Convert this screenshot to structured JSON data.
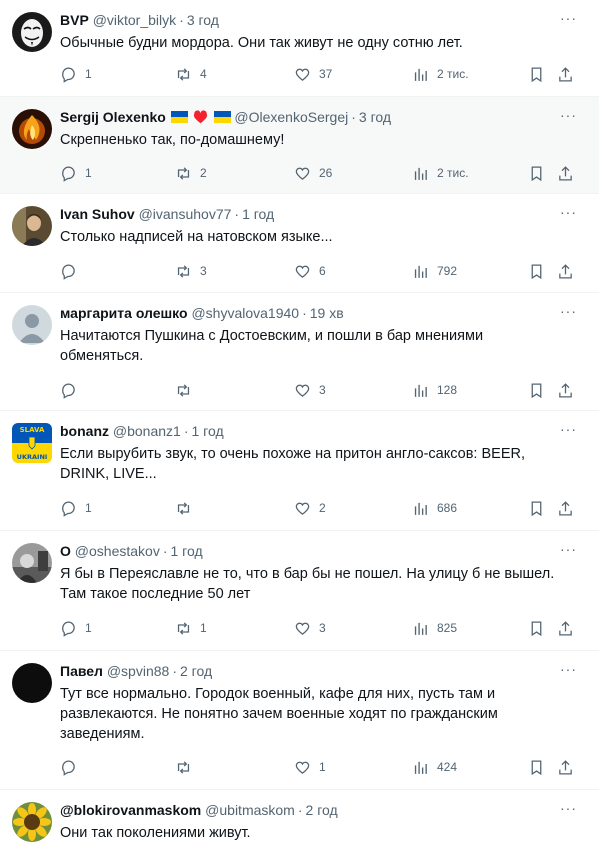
{
  "replies": [
    {
      "name": "BVP",
      "handle": "@viktor_bilyk",
      "time": "3 год",
      "text": "Обычные будни мордора. Они так живут не одну сотню лет.",
      "replies": "1",
      "reposts": "4",
      "likes": "37",
      "views": "2 тис.",
      "highlight": false,
      "avatar": "anonymous-mask"
    },
    {
      "name": "Sergij Olexenko",
      "handle": "@OlexenkoSergej",
      "time": "3 год",
      "text": "Скрепненько так, по-домашнему!",
      "replies": "1",
      "reposts": "2",
      "likes": "26",
      "views": "2 тис.",
      "highlight": true,
      "avatar": "fire"
    },
    {
      "name": "Ivan Suhov",
      "handle": "@ivansuhov77",
      "time": "1 год",
      "text": "Столько надписей на натовском языке...",
      "replies": "",
      "reposts": "3",
      "likes": "6",
      "views": "792",
      "highlight": false,
      "avatar": "man-photo"
    },
    {
      "name": "маргарита олешко",
      "handle": "@shyvalova1940",
      "time": "19 хв",
      "text": "Начитаются Пушкина с Достоевским, и пошли в бар мнениями обменяться.",
      "replies": "",
      "reposts": "",
      "likes": "3",
      "views": "128",
      "highlight": false,
      "avatar": "default-user"
    },
    {
      "name": "bonanz",
      "handle": "@bonanz1",
      "time": "1 год",
      "text": "Если вырубить звук, то очень похоже на притон англо-саксов: BEER, DRINK, LIVE...",
      "replies": "1",
      "reposts": "",
      "likes": "2",
      "views": "686",
      "highlight": false,
      "avatar": "slava-ukraini",
      "avatar_text": {
        "top": "SLAVA",
        "bottom": "UKRAINI"
      }
    },
    {
      "name": "O",
      "handle": "@oshestakov",
      "time": "1 год",
      "text": "Я бы в Переяславле не то, что в бар бы не пошел. На улицу б не вышел. Там такое последние 50 лет",
      "replies": "1",
      "reposts": "1",
      "likes": "3",
      "views": "825",
      "highlight": false,
      "avatar": "bw-photo"
    },
    {
      "name": "Павел",
      "handle": "@spvin88",
      "time": "2 год",
      "text": "Тут все нормально. Городок военный, кафе для них, пусть там и развлекаются. Не понятно зачем военные ходят по гражданским заведениям.",
      "replies": "",
      "reposts": "",
      "likes": "1",
      "views": "424",
      "highlight": false,
      "avatar": "dark"
    },
    {
      "name": "@blokirovanmaskom",
      "handle": "@ubitmaskom",
      "time": "2 год",
      "text": "Они так поколениями живут.",
      "replies": "",
      "reposts": "",
      "likes": "",
      "views": "",
      "highlight": false,
      "avatar": "sunflower"
    }
  ],
  "more_glyph": "···",
  "dot": "·",
  "colors": {
    "text": "#0f1419",
    "muted": "#536471",
    "border": "#eff3f4",
    "highlight_bg": "#f7f9f9",
    "flag_blue": "#0057b7",
    "flag_yellow": "#ffd700",
    "heart": "#f4212e"
  }
}
